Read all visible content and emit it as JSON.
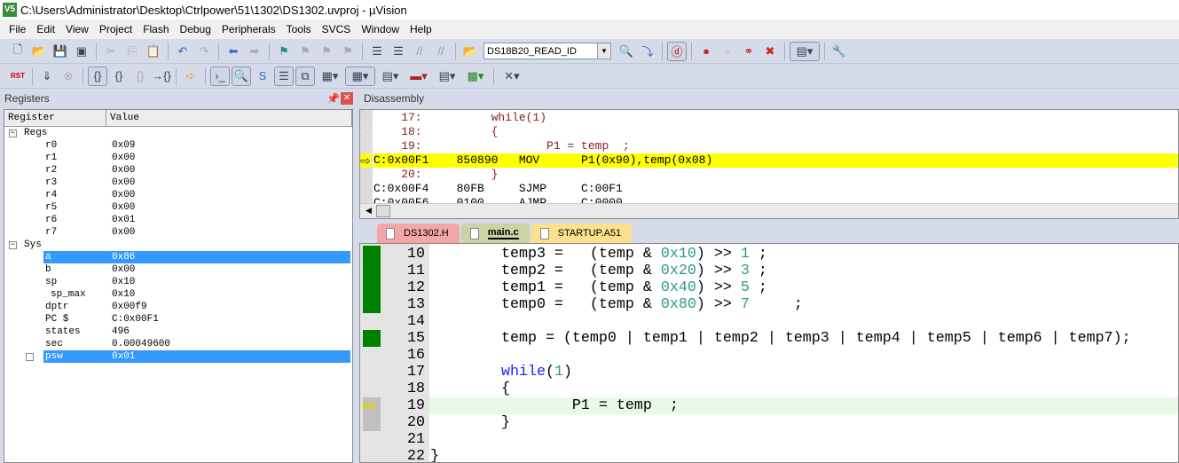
{
  "window": {
    "title": "C:\\Users\\Administrator\\Desktop\\Ctrlpower\\51\\1302\\DS1302.uvproj - µVision",
    "icon": "V5"
  },
  "menu": [
    "File",
    "Edit",
    "View",
    "Project",
    "Flash",
    "Debug",
    "Peripherals",
    "Tools",
    "SVCS",
    "Window",
    "Help"
  ],
  "toolbar1": {
    "target": "DS18B20_READ_ID"
  },
  "registers": {
    "title": "Registers",
    "columns": [
      "Register",
      "Value"
    ],
    "groups": [
      {
        "name": "Regs",
        "items": [
          {
            "n": "r0",
            "v": "0x09"
          },
          {
            "n": "r1",
            "v": "0x00"
          },
          {
            "n": "r2",
            "v": "0x00"
          },
          {
            "n": "r3",
            "v": "0x00"
          },
          {
            "n": "r4",
            "v": "0x00"
          },
          {
            "n": "r5",
            "v": "0x00"
          },
          {
            "n": "r6",
            "v": "0x01"
          },
          {
            "n": "r7",
            "v": "0x00"
          }
        ]
      },
      {
        "name": "Sys",
        "items": [
          {
            "n": "a",
            "v": "0x86",
            "sel": true
          },
          {
            "n": "b",
            "v": "0x00"
          },
          {
            "n": "sp",
            "v": "0x10"
          },
          {
            "n": "sp_max",
            "v": "0x10",
            "indent": true
          },
          {
            "n": "dptr",
            "v": "0x00f9"
          },
          {
            "n": "PC  $",
            "v": "C:0x00F1"
          },
          {
            "n": "states",
            "v": "496"
          },
          {
            "n": "sec",
            "v": "0.00049600"
          },
          {
            "n": "psw",
            "v": "0x01",
            "sel": true,
            "expand": true
          }
        ]
      }
    ]
  },
  "disassembly": {
    "title": "Disassembly",
    "lines": [
      {
        "t": "    17:          while(1)",
        "k": "src"
      },
      {
        "t": "    18:          {",
        "k": "src"
      },
      {
        "t": "    19:                  P1 = temp  ;",
        "k": "src"
      },
      {
        "t": "C:0x00F1    850890   MOV      P1(0x90),temp(0x08)",
        "k": "cur"
      },
      {
        "t": "    20:          }",
        "k": "src"
      },
      {
        "t": "C:0x00F4    80FB     SJMP     C:00F1",
        "k": "asm"
      },
      {
        "t": "C:0x00F6    0100     AJMP     C:0000",
        "k": "asm"
      }
    ]
  },
  "tabs": [
    {
      "label": "DS1302.H",
      "color": "#f2a6a6"
    },
    {
      "label": "main.c",
      "color": "#c9d3a4",
      "active": true
    },
    {
      "label": "STARTUP.A51",
      "color": "#fde08c"
    }
  ],
  "editor": {
    "lines": [
      {
        "n": "10",
        "mark": "green",
        "s": [
          [
            "        temp3 =   (temp & ",
            ""
          ],
          [
            "0x10",
            "nm"
          ],
          [
            ") >> ",
            ""
          ],
          [
            "1",
            "nm"
          ],
          [
            " ;",
            ""
          ]
        ]
      },
      {
        "n": "11",
        "mark": "green",
        "s": [
          [
            "        temp2 =   (temp & ",
            ""
          ],
          [
            "0x20",
            "nm"
          ],
          [
            ") >> ",
            ""
          ],
          [
            "3",
            "nm"
          ],
          [
            " ;",
            ""
          ]
        ]
      },
      {
        "n": "12",
        "mark": "green",
        "s": [
          [
            "        temp1 =   (temp & ",
            ""
          ],
          [
            "0x40",
            "nm"
          ],
          [
            ") >> ",
            ""
          ],
          [
            "5",
            "nm"
          ],
          [
            " ;",
            ""
          ]
        ]
      },
      {
        "n": "13",
        "mark": "green",
        "s": [
          [
            "        temp0 =   (temp & ",
            ""
          ],
          [
            "0x80",
            "nm"
          ],
          [
            ") >> ",
            ""
          ],
          [
            "7",
            "nm"
          ],
          [
            "     ;",
            ""
          ]
        ]
      },
      {
        "n": "14",
        "s": []
      },
      {
        "n": "15",
        "mark": "green",
        "s": [
          [
            "        temp = (temp0 | temp1 | temp2 | temp3 | temp4 | temp5 | temp6 | temp7);",
            ""
          ]
        ]
      },
      {
        "n": "16",
        "s": []
      },
      {
        "n": "17",
        "s": [
          [
            "        ",
            ""
          ],
          [
            "while",
            "kw"
          ],
          [
            "(",
            ""
          ],
          [
            "1",
            "nm"
          ],
          [
            ")",
            ""
          ]
        ]
      },
      {
        "n": "18",
        "s": [
          [
            "        {",
            ""
          ]
        ]
      },
      {
        "n": "19",
        "mark": "arrow",
        "cur": true,
        "s": [
          [
            "                P1 = temp  ;",
            ""
          ]
        ]
      },
      {
        "n": "20",
        "mark": "gray",
        "s": [
          [
            "        }",
            ""
          ]
        ]
      },
      {
        "n": "21",
        "s": []
      },
      {
        "n": "22",
        "s": [
          [
            "}",
            ""
          ]
        ]
      }
    ]
  },
  "colors": {
    "selection": "#3399ff",
    "current_line": "#ffff00",
    "coverage": "#008000"
  }
}
